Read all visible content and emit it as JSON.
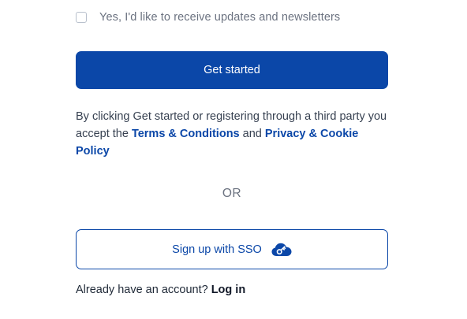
{
  "newsletter": {
    "label": "Yes, I'd like to receive updates and newsletters",
    "checked": false
  },
  "primary_button": {
    "label": "Get started",
    "color": "#0b47a8"
  },
  "legal": {
    "prefix": "By clicking Get started or registering through a third party you accept the ",
    "terms_link": "Terms & Conditions",
    "conjunction": " and ",
    "privacy_link": "Privacy & Cookie Policy"
  },
  "divider": {
    "label": "OR"
  },
  "sso_button": {
    "label": "Sign up with SSO",
    "icon": "cloud-key-icon"
  },
  "login": {
    "prompt": "Already have an account?",
    "link": "Log in"
  }
}
